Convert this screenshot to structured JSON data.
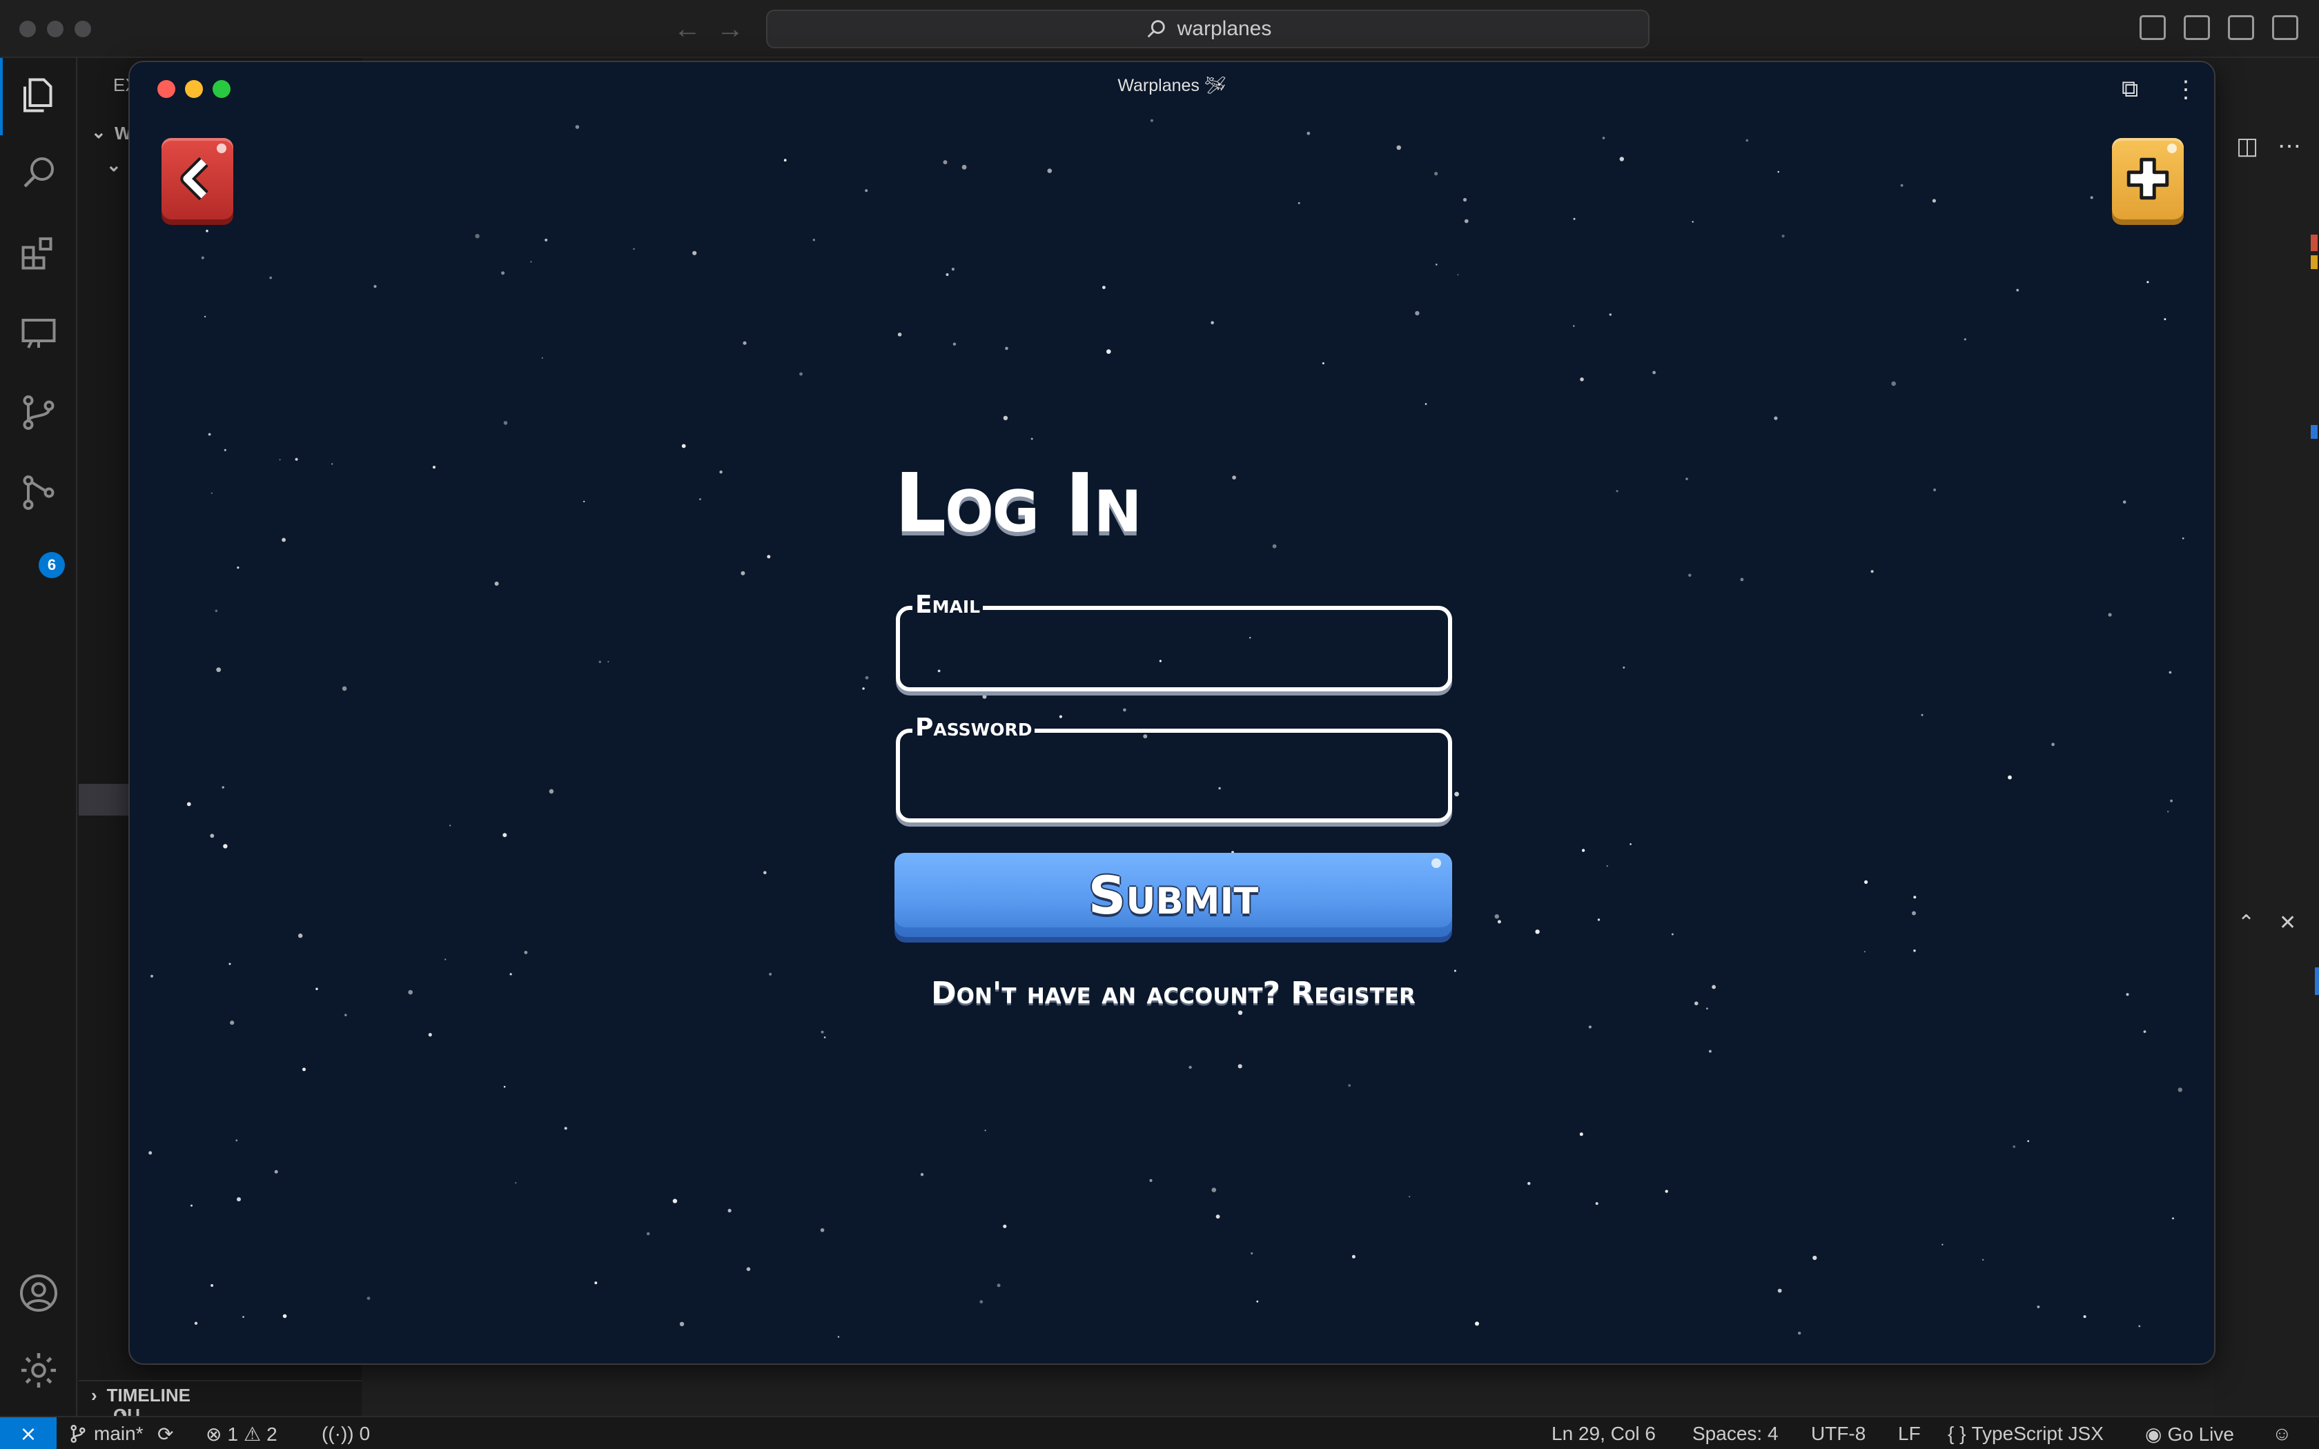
{
  "titlebar": {
    "search_text": "warplanes"
  },
  "activity": {
    "source_control_badge": "6"
  },
  "sidebar": {
    "explorer_fragment": "EX",
    "folder_fragment": "W",
    "outline_fragment": "OU",
    "timeline_label": "TIMELINE"
  },
  "game": {
    "window_title": "Warplanes 🛩",
    "heading": "Log In",
    "email_label": "Email",
    "email_value": "",
    "password_label": "Password",
    "password_value": "",
    "submit_label": "Submit",
    "register_prompt": "Don't have an account? ",
    "register_link": "Register"
  },
  "statusbar": {
    "branch": "main*",
    "errors": "1",
    "warnings": "2",
    "ports": "0",
    "cursor": "Ln 29, Col 6",
    "spaces": "Spaces: 4",
    "encoding": "UTF-8",
    "eol": "LF",
    "language": "TypeScript JSX",
    "go_live": "Go Live"
  },
  "colors": {
    "game_background": "#0b172a",
    "back_button": "#d63d38",
    "add_button": "#f0b448",
    "submit_button": "#5b9bf0",
    "vscode_accent": "#0078d4"
  }
}
